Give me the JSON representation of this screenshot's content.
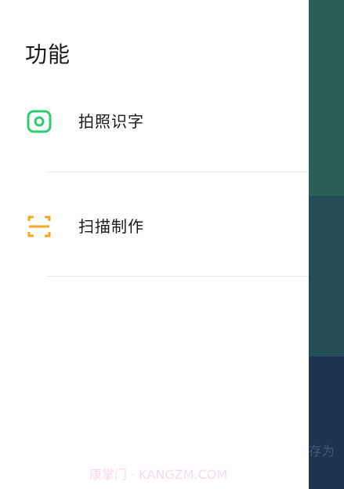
{
  "background": {
    "text": "存为",
    "colors": [
      "#2a5f56",
      "#234e56",
      "#1f3450"
    ]
  },
  "drawer": {
    "title": "功能",
    "items": [
      {
        "label": "拍照识字",
        "icon": "camera-icon",
        "color": "#2ecc71"
      },
      {
        "label": "扫描制作",
        "icon": "scan-icon",
        "color": "#f5a623"
      }
    ]
  },
  "watermark": "康掌门 · KANGZM.COM"
}
